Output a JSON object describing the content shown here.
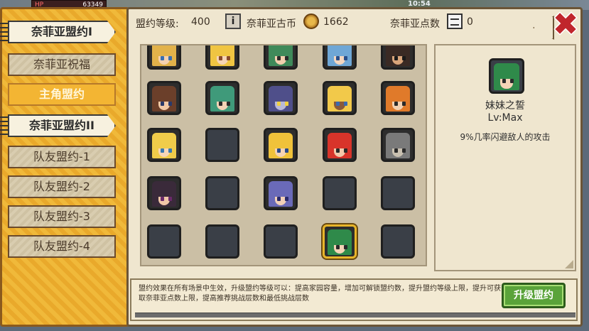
{
  "hud": {
    "hp_label": "HP",
    "hp_value": "63349",
    "time": "10:54"
  },
  "tabs": [
    {
      "label": "奈菲亚盟约I",
      "state": "active"
    },
    {
      "label": "奈菲亚祝福",
      "state": "normal"
    },
    {
      "label": "主角盟约",
      "state": "hero"
    },
    {
      "label": "奈菲亚盟约II",
      "state": "active"
    },
    {
      "label": "队友盟约-1",
      "state": "normal"
    },
    {
      "label": "队友盟约-2",
      "state": "normal"
    },
    {
      "label": "队友盟约-3",
      "state": "normal"
    },
    {
      "label": "队友盟约-4",
      "state": "normal"
    }
  ],
  "header": {
    "level_label": "盟约等级:",
    "level_value": "400",
    "coin_label": "奈菲亚古币",
    "coin_value": "1662",
    "points_label": "奈菲亚点数",
    "points_value": "0"
  },
  "grid": {
    "cells": [
      {
        "hair": "#e2b24a",
        "skin": "#f4d1b0",
        "eye": "#3a6fb0",
        "filled": true
      },
      {
        "hair": "#f0c542",
        "skin": "#f6d5b6",
        "eye": "#8a4a2a",
        "filled": true
      },
      {
        "hair": "#3f8a5a",
        "skin": "#f2cfae",
        "eye": "#2a2a2a",
        "filled": true
      },
      {
        "hair": "#6fa7d6",
        "skin": "#f4d7c0",
        "eye": "#2a4f8a",
        "filled": true
      },
      {
        "hair": "#3a2a24",
        "skin": "#d9a57a",
        "eye": "#1a1a1a",
        "filled": true
      },
      {
        "hair": "#6b3f2a",
        "skin": "#f1c9a6",
        "eye": "#2a3a6a",
        "filled": true
      },
      {
        "hair": "#3f9a7a",
        "skin": "#f3d3b6",
        "eye": "#2a2a2a",
        "filled": true
      },
      {
        "hair": "#4f4f8a",
        "skin": "#b8b8d8",
        "eye": "#f0d040",
        "filled": true
      },
      {
        "hair": "#f2c94a",
        "skin": "#8a5a3a",
        "eye": "#3a6ab0",
        "filled": true
      },
      {
        "hair": "#e07a2a",
        "skin": "#f3d0b0",
        "eye": "#2a2a2a",
        "filled": true
      },
      {
        "hair": "#f0cc4a",
        "skin": "#f6d6b8",
        "eye": "#3a7ab0",
        "filled": true
      },
      {
        "filled": false
      },
      {
        "hair": "#f0c23a",
        "skin": "#f4d3b3",
        "eye": "#2a4a8a",
        "filled": true
      },
      {
        "hair": "#d8342a",
        "skin": "#f3c9aa",
        "eye": "#2a2a2a",
        "filled": true
      },
      {
        "hair": "#7a7a7a",
        "skin": "#c9c0b0",
        "eye": "#2a2a2a",
        "filled": true
      },
      {
        "hair": "#3a2a3a",
        "skin": "#f1c7a8",
        "eye": "#6a2a6a",
        "filled": true
      },
      {
        "filled": false
      },
      {
        "hair": "#6a6ab8",
        "skin": "#f1d0b8",
        "eye": "#2a2a6a",
        "filled": true
      },
      {
        "filled": false
      },
      {
        "filled": false
      },
      {
        "filled": false
      },
      {
        "filled": false
      },
      {
        "filled": false
      },
      {
        "hair": "#2f8a4a",
        "skin": "#f4d3b6",
        "eye": "#2a2a2a",
        "filled": true,
        "selected": true
      },
      {
        "filled": false
      }
    ]
  },
  "detail": {
    "name": "妹妹之誓",
    "level": "Lv:Max",
    "description": "9%几率闪避敌人的攻击",
    "portrait": {
      "hair": "#2f8a4a",
      "skin": "#f4d3b6",
      "eye": "#2a2a2a"
    }
  },
  "footer": {
    "text": "盟约效果在所有场景中生效，升级盟约等级可以：提高家园容量，增加可解锁盟约数，提升盟约等级上限，提升可获取奈菲亚点数上限，提高推荐挑战层数和最低挑战层数",
    "upgrade_label": "升级盟约"
  },
  "colors": {
    "accent": "#f0b93a",
    "panel": "#efe6cf",
    "upgrade": "#5aa33a",
    "close": "#c0262c",
    "selected": "#e8b52a"
  }
}
